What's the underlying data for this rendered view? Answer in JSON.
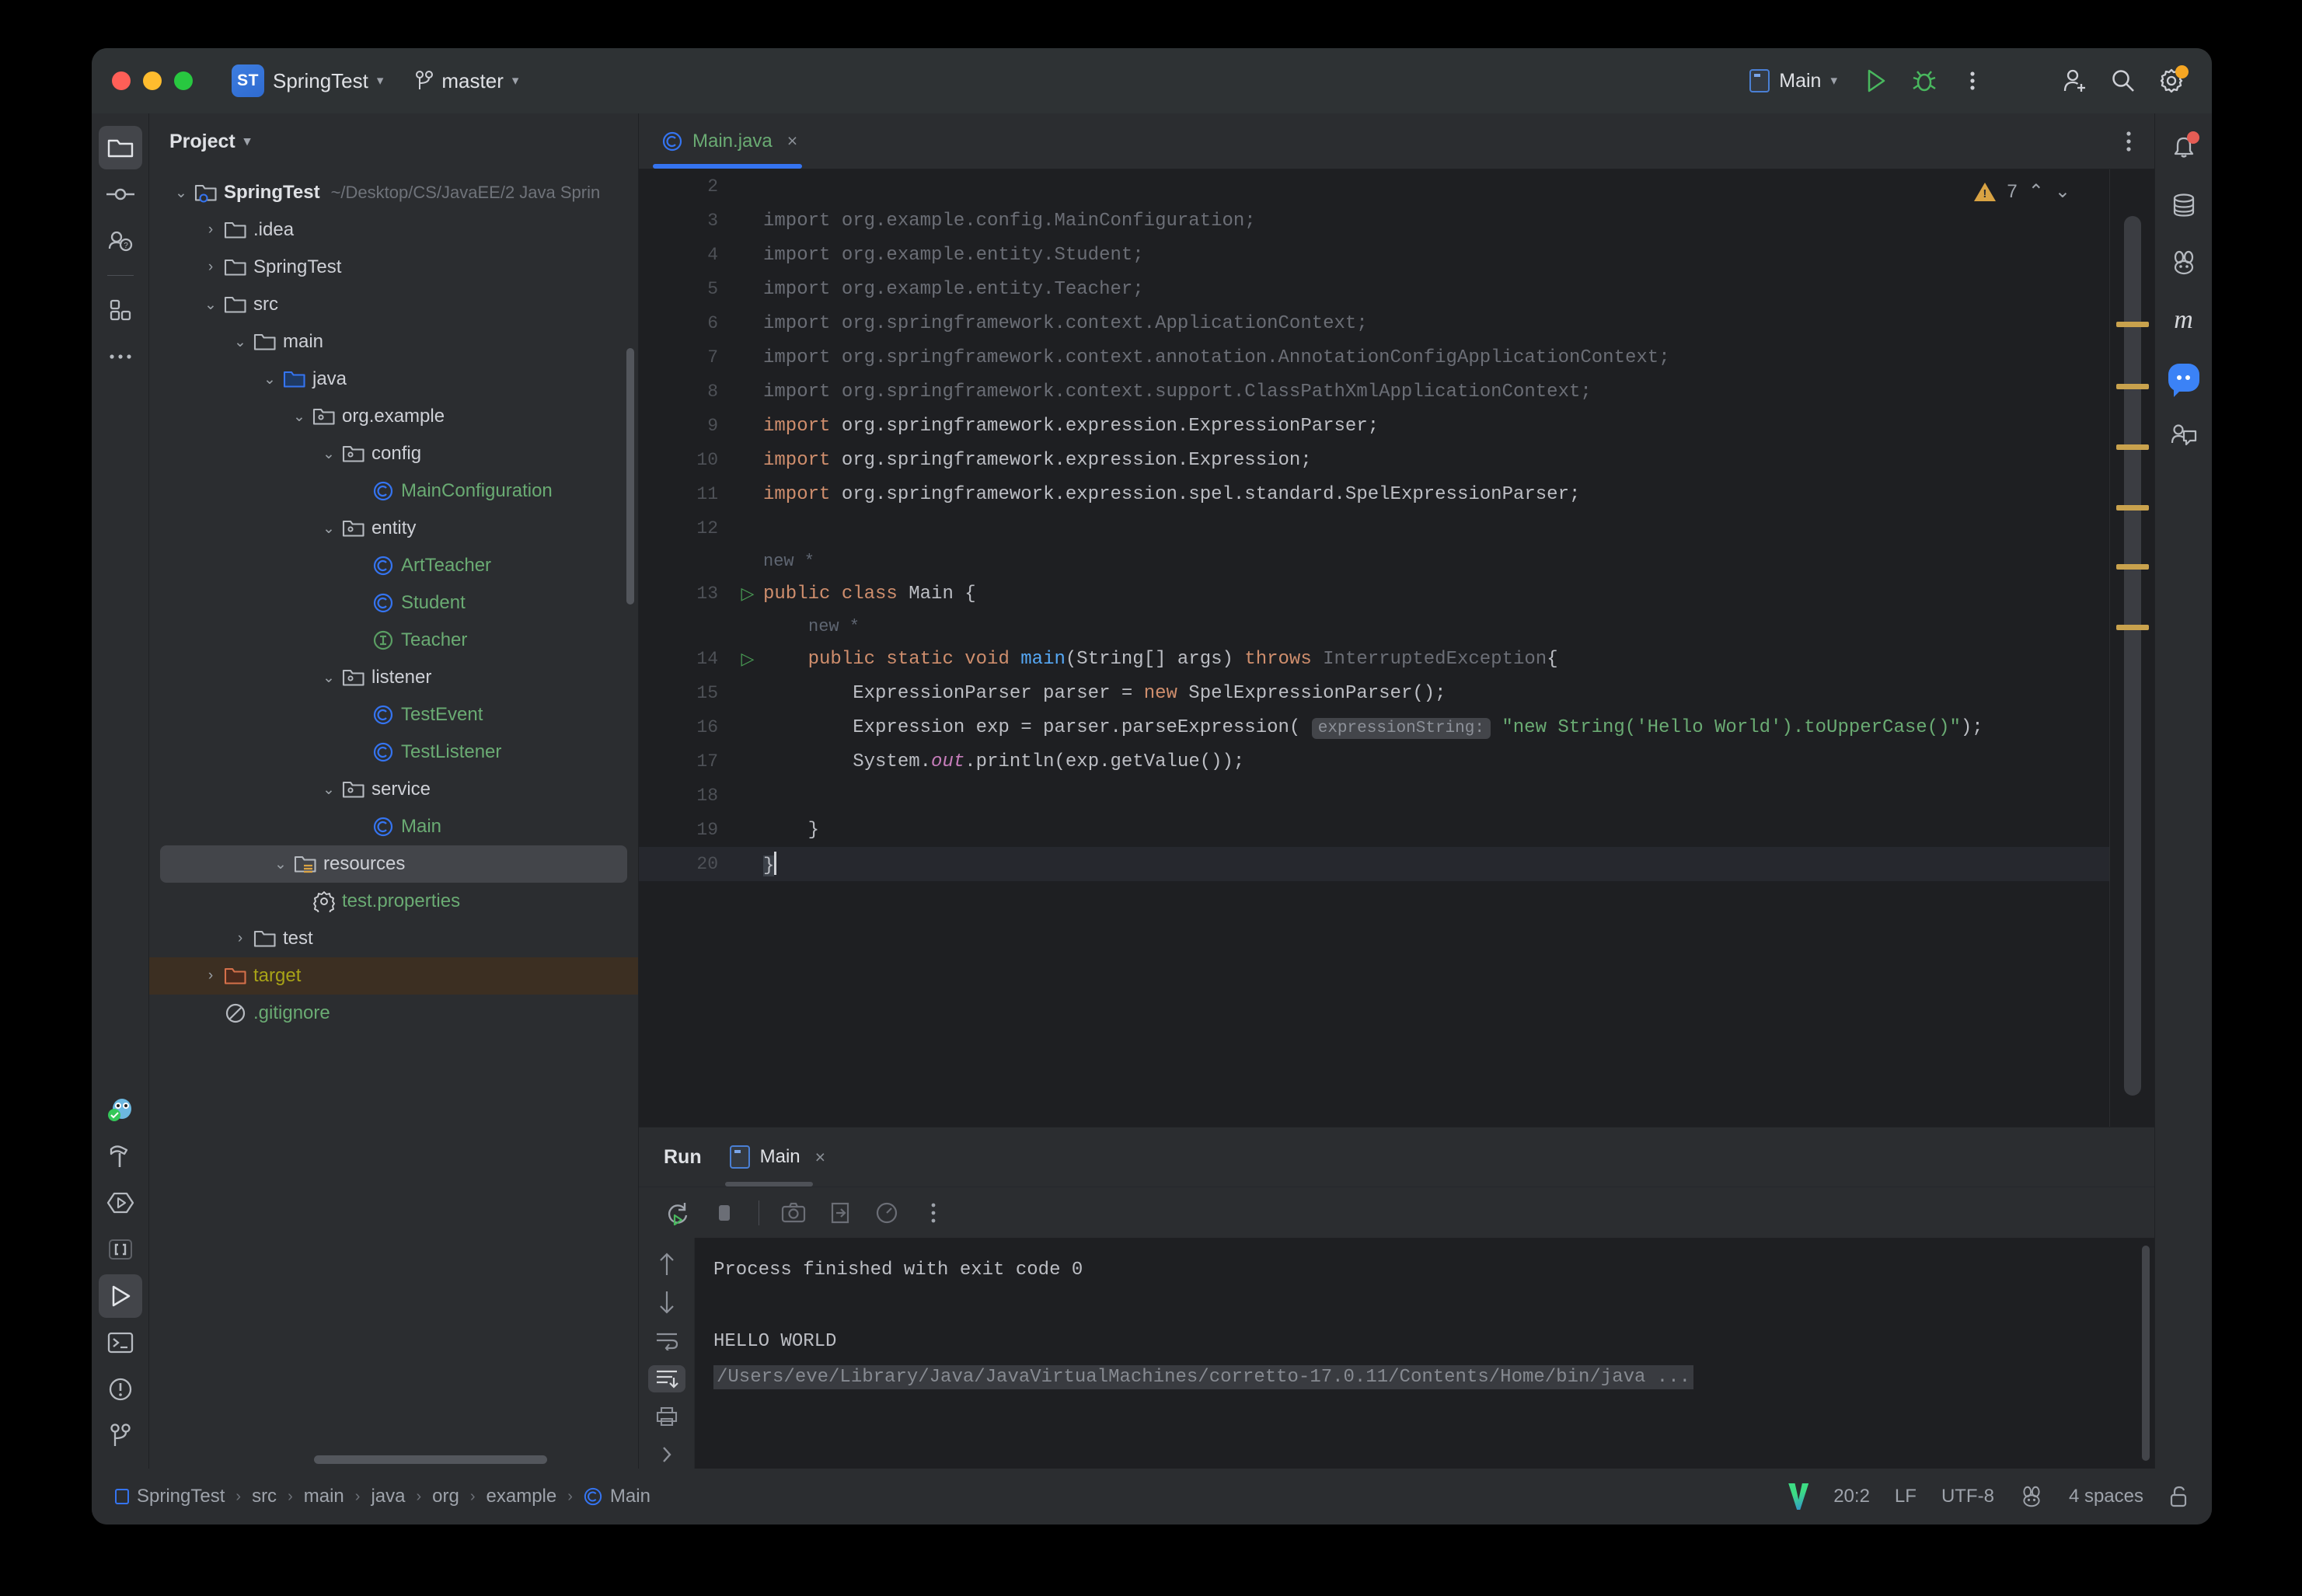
{
  "titlebar": {
    "project_name": "SpringTest",
    "project_badge": "ST",
    "branch": "master",
    "run_config": "Main",
    "icons": {
      "run": "run-icon",
      "debug": "debug-icon",
      "more": "more-options-icon",
      "account": "add-account-icon",
      "search": "search-icon",
      "settings": "settings-gear-icon"
    }
  },
  "left_rail": {
    "items": [
      {
        "name": "project",
        "icon": "folder-icon",
        "active": true
      },
      {
        "name": "commit",
        "icon": "commit-icon",
        "active": false
      },
      {
        "name": "pull-requests",
        "icon": "pull-request-icon",
        "active": false
      },
      {
        "name": "structure",
        "icon": "structure-blocks-icon",
        "active": false
      },
      {
        "name": "more-tool-windows",
        "icon": "ellipsis-icon",
        "active": false
      }
    ],
    "bottom_items": [
      {
        "name": "ai-assistant",
        "icon": "owl-icon",
        "active": false
      },
      {
        "name": "build",
        "icon": "hammer-icon",
        "active": false
      },
      {
        "name": "services",
        "icon": "services-icon",
        "active": false
      },
      {
        "name": "bookmarks",
        "icon": "brackets-icon",
        "active": false
      },
      {
        "name": "run",
        "icon": "play-icon",
        "active": true
      },
      {
        "name": "terminal",
        "icon": "terminal-icon",
        "active": false
      },
      {
        "name": "problems",
        "icon": "warning-circle-icon",
        "active": false
      },
      {
        "name": "version-control",
        "icon": "branch-icon",
        "active": false
      }
    ]
  },
  "right_rail": {
    "items": [
      {
        "name": "notifications",
        "icon": "bell-icon",
        "badge": true
      },
      {
        "name": "database",
        "icon": "database-icon",
        "badge": false
      },
      {
        "name": "bunny-tool",
        "icon": "bunny-icon",
        "badge": false
      },
      {
        "name": "maven",
        "icon": "maven-m-icon",
        "badge": false
      },
      {
        "name": "ai-chat",
        "icon": "chat-bubble-icon",
        "badge": false
      },
      {
        "name": "code-with-me",
        "icon": "code-with-me-icon",
        "badge": false
      }
    ]
  },
  "project_panel": {
    "title": "Project",
    "tree": [
      {
        "depth": 0,
        "twist": "v",
        "icon": "module-folder-icon",
        "label": "SpringTest",
        "style": "bold",
        "path": "~/Desktop/CS/JavaEE/2 Java Sprin",
        "state": "normal"
      },
      {
        "depth": 1,
        "twist": ">",
        "icon": "folder-icon",
        "label": ".idea",
        "style": "plain",
        "path": "",
        "state": "normal"
      },
      {
        "depth": 1,
        "twist": ">",
        "icon": "folder-icon",
        "label": "SpringTest",
        "style": "plain",
        "path": "",
        "state": "normal"
      },
      {
        "depth": 1,
        "twist": "v",
        "icon": "folder-icon",
        "label": "src",
        "style": "plain",
        "path": "",
        "state": "normal"
      },
      {
        "depth": 2,
        "twist": "v",
        "icon": "folder-icon",
        "label": "main",
        "style": "plain",
        "path": "",
        "state": "normal"
      },
      {
        "depth": 3,
        "twist": "v",
        "icon": "source-folder-icon",
        "label": "java",
        "style": "plain",
        "path": "",
        "state": "normal"
      },
      {
        "depth": 4,
        "twist": "v",
        "icon": "package-icon",
        "label": "org.example",
        "style": "plain",
        "path": "",
        "state": "normal"
      },
      {
        "depth": 5,
        "twist": "v",
        "icon": "package-icon",
        "label": "config",
        "style": "plain",
        "path": "",
        "state": "normal"
      },
      {
        "depth": 6,
        "twist": "",
        "icon": "class-icon",
        "label": "MainConfiguration",
        "style": "green",
        "path": "",
        "state": "normal"
      },
      {
        "depth": 5,
        "twist": "v",
        "icon": "package-icon",
        "label": "entity",
        "style": "plain",
        "path": "",
        "state": "normal"
      },
      {
        "depth": 6,
        "twist": "",
        "icon": "class-icon",
        "label": "ArtTeacher",
        "style": "green",
        "path": "",
        "state": "normal"
      },
      {
        "depth": 6,
        "twist": "",
        "icon": "class-icon",
        "label": "Student",
        "style": "green",
        "path": "",
        "state": "normal"
      },
      {
        "depth": 6,
        "twist": "",
        "icon": "interface-icon",
        "label": "Teacher",
        "style": "green",
        "path": "",
        "state": "normal"
      },
      {
        "depth": 5,
        "twist": "v",
        "icon": "package-icon",
        "label": "listener",
        "style": "plain",
        "path": "",
        "state": "normal"
      },
      {
        "depth": 6,
        "twist": "",
        "icon": "class-icon",
        "label": "TestEvent",
        "style": "green",
        "path": "",
        "state": "normal"
      },
      {
        "depth": 6,
        "twist": "",
        "icon": "class-icon",
        "label": "TestListener",
        "style": "green",
        "path": "",
        "state": "normal"
      },
      {
        "depth": 5,
        "twist": "v",
        "icon": "package-icon",
        "label": "service",
        "style": "plain",
        "path": "",
        "state": "normal"
      },
      {
        "depth": 6,
        "twist": "",
        "icon": "class-icon",
        "label": "Main",
        "style": "green",
        "path": "",
        "state": "normal"
      },
      {
        "depth": 3,
        "twist": "v",
        "icon": "resource-folder-icon",
        "label": "resources",
        "style": "plain",
        "path": "",
        "state": "selected"
      },
      {
        "depth": 4,
        "twist": "",
        "icon": "properties-icon",
        "label": "test.properties",
        "style": "green",
        "path": "",
        "state": "normal"
      },
      {
        "depth": 2,
        "twist": ">",
        "icon": "folder-icon",
        "label": "test",
        "style": "plain",
        "path": "",
        "state": "normal"
      },
      {
        "depth": 1,
        "twist": ">",
        "icon": "excluded-folder-icon",
        "label": "target",
        "style": "olive",
        "path": "",
        "state": "excluded"
      },
      {
        "depth": 1,
        "twist": "",
        "icon": "gitignore-icon",
        "label": ".gitignore",
        "style": "green",
        "path": "",
        "state": "normal"
      }
    ]
  },
  "editor": {
    "tab": {
      "label": "Main.java",
      "icon": "class-icon",
      "close": "×"
    },
    "more_icon": "tab-more-icon",
    "inspection": {
      "warning_count": "7",
      "up": "⌃",
      "down": "⌄"
    },
    "lines": [
      {
        "num": "2",
        "gutter": "",
        "segments": [],
        "hint": ""
      },
      {
        "num": "3",
        "gutter": "",
        "segments": [
          {
            "t": "import org.example.config.MainConfiguration;",
            "c": "dim"
          }
        ]
      },
      {
        "num": "4",
        "gutter": "",
        "segments": [
          {
            "t": "import org.example.entity.Student;",
            "c": "dim"
          }
        ]
      },
      {
        "num": "5",
        "gutter": "",
        "segments": [
          {
            "t": "import org.example.entity.Teacher;",
            "c": "dim"
          }
        ]
      },
      {
        "num": "6",
        "gutter": "",
        "segments": [
          {
            "t": "import org.springframework.context.ApplicationContext;",
            "c": "dim"
          }
        ]
      },
      {
        "num": "7",
        "gutter": "",
        "segments": [
          {
            "t": "import org.springframework.context.annotation.AnnotationConfigApplicationContext;",
            "c": "dim"
          }
        ]
      },
      {
        "num": "8",
        "gutter": "",
        "segments": [
          {
            "t": "import org.springframework.context.support.ClassPathXmlApplicationContext;",
            "c": "dim"
          }
        ]
      },
      {
        "num": "9",
        "gutter": "",
        "segments": [
          {
            "t": "import",
            "c": "kw"
          },
          {
            "t": " org.springframework.expression.ExpressionParser;",
            "c": "plain"
          }
        ]
      },
      {
        "num": "10",
        "gutter": "",
        "segments": [
          {
            "t": "import",
            "c": "kw"
          },
          {
            "t": " org.springframework.expression.Expression;",
            "c": "plain"
          }
        ]
      },
      {
        "num": "11",
        "gutter": "",
        "segments": [
          {
            "t": "import",
            "c": "kw"
          },
          {
            "t": " org.springframework.expression.spel.standard.SpelExpressionParser;",
            "c": "plain"
          }
        ]
      },
      {
        "num": "12",
        "gutter": "",
        "segments": []
      },
      {
        "num": "13",
        "gutter": "run",
        "hint": "new *",
        "segments": [
          {
            "t": "public class",
            "c": "kw"
          },
          {
            "t": " Main ",
            "c": "plain"
          },
          {
            "t": "{",
            "c": "bracket"
          }
        ]
      },
      {
        "num": "14",
        "gutter": "run",
        "hint_indent": "new *",
        "segments": [
          {
            "t": "    ",
            "c": "plain"
          },
          {
            "t": "public static void",
            "c": "kw"
          },
          {
            "t": " ",
            "c": "plain"
          },
          {
            "t": "main",
            "c": "meth"
          },
          {
            "t": "(String[] args) ",
            "c": "plain"
          },
          {
            "t": "throws",
            "c": "kw"
          },
          {
            "t": " ",
            "c": "plain"
          },
          {
            "t": "InterruptedException",
            "c": "dim"
          },
          {
            "t": "{",
            "c": "plain"
          }
        ]
      },
      {
        "num": "15",
        "gutter": "",
        "segments": [
          {
            "t": "        ExpressionParser parser = ",
            "c": "plain"
          },
          {
            "t": "new",
            "c": "kw"
          },
          {
            "t": " SpelExpressionParser();",
            "c": "plain"
          }
        ]
      },
      {
        "num": "16",
        "gutter": "",
        "segments": [
          {
            "t": "        Expression exp = parser.parseExpression( ",
            "c": "plain"
          },
          {
            "t": "expressionString:",
            "c": "chip"
          },
          {
            "t": " ",
            "c": "plain"
          },
          {
            "t": "\"new String('Hello World').toUpperCase()\"",
            "c": "str"
          },
          {
            "t": ");",
            "c": "plain"
          }
        ]
      },
      {
        "num": "17",
        "gutter": "",
        "segments": [
          {
            "t": "        System.",
            "c": "plain"
          },
          {
            "t": "out",
            "c": "field"
          },
          {
            "t": ".println(exp.getValue());",
            "c": "plain"
          }
        ]
      },
      {
        "num": "18",
        "gutter": "",
        "segments": []
      },
      {
        "num": "19",
        "gutter": "",
        "segments": [
          {
            "t": "    }",
            "c": "plain"
          }
        ]
      },
      {
        "num": "20",
        "gutter": "",
        "segments": [
          {
            "t": "}",
            "c": "bracket-hl"
          }
        ],
        "current": true
      }
    ]
  },
  "run_panel": {
    "title": "Run",
    "tab": {
      "label": "Main",
      "icon": "run-config-icon",
      "close": "×"
    },
    "toolbar": [
      {
        "name": "rerun",
        "icon": "rerun-icon"
      },
      {
        "name": "stop",
        "icon": "stop-icon"
      },
      {
        "name": "screenshot",
        "icon": "camera-icon"
      },
      {
        "name": "export",
        "icon": "export-icon"
      },
      {
        "name": "profiler",
        "icon": "profiler-icon"
      },
      {
        "name": "more",
        "icon": "more-options-icon"
      }
    ],
    "console_rail": [
      {
        "name": "scroll-up",
        "icon": "arrow-up-icon",
        "active": false
      },
      {
        "name": "scroll-down",
        "icon": "arrow-down-icon",
        "active": false
      },
      {
        "name": "soft-wrap",
        "icon": "soft-wrap-icon",
        "active": false
      },
      {
        "name": "scroll-to-end",
        "icon": "scroll-end-icon",
        "active": true
      },
      {
        "name": "print",
        "icon": "print-icon",
        "active": false
      },
      {
        "name": "expand",
        "icon": "chevron-right-icon",
        "active": false
      }
    ],
    "output": [
      {
        "text": "/Users/eve/Library/Java/JavaVirtualMachines/corretto-17.0.11/Contents/Home/bin/java ...",
        "style": "cmd"
      },
      {
        "text": "HELLO WORLD",
        "style": "plain"
      },
      {
        "text": "",
        "style": "plain"
      },
      {
        "text": "Process finished with exit code 0",
        "style": "plain"
      }
    ]
  },
  "statusbar": {
    "breadcrumbs": [
      "SpringTest",
      "src",
      "main",
      "java",
      "org",
      "example",
      "Main"
    ],
    "caret_position": "20:2",
    "line_separator": "LF",
    "encoding": "UTF-8",
    "indent": "4 spaces",
    "icons": {
      "vcs": "version-logo-icon",
      "bunny": "bunny-icon",
      "lock": "unlocked-icon"
    }
  }
}
